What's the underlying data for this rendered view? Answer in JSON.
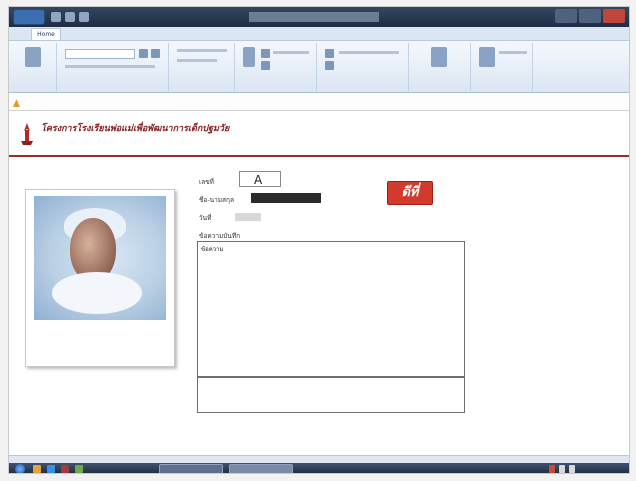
{
  "window": {
    "title": "",
    "accent": "#1d2d44"
  },
  "ribbon": {
    "tabs": [
      "Home",
      "",
      "",
      "",
      "",
      "",
      ""
    ],
    "groups": [
      "",
      "",
      "",
      "",
      "",
      "",
      ""
    ],
    "icon_names": [
      "view-icon",
      "paste-icon",
      "filter-icon",
      "sort-icon",
      "refresh-icon",
      "find-icon",
      "text-format-icon"
    ]
  },
  "address": {
    "warning_text": "",
    "path_text": "",
    "extra_text": ""
  },
  "banner": {
    "title": "โครงการโรงเรียนพ่อแม่เพื่อพัฒนาการเด็กปฐมวัย",
    "subtitle": "",
    "title_color": "#8b2020"
  },
  "form": {
    "id_label": "เลขที่",
    "id_value": "A",
    "name_label": "ชื่อ-นามสกุล",
    "name_value": "",
    "date_label": "วันที่",
    "date_value": "",
    "remark_label": "ข้อความบันทึก",
    "remark_value": "ข้อความ",
    "extra_label": "",
    "extra_value": "",
    "print_button": "ดีที่",
    "print_color": "#d23a2c"
  },
  "statusbar": {
    "text": ""
  },
  "taskbar": {
    "window_label": "",
    "clock": ""
  }
}
